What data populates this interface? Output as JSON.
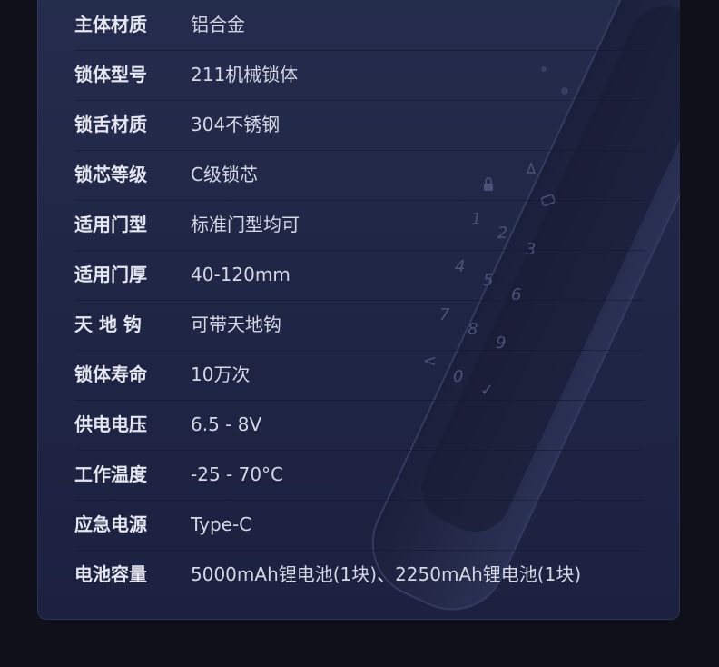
{
  "specs": [
    {
      "label": "主体材质",
      "value": "铝合金"
    },
    {
      "label": "锁体型号",
      "value": "211机械锁体"
    },
    {
      "label": "锁舌材质",
      "value": "304不锈钢"
    },
    {
      "label": "锁芯等级",
      "value": "C级锁芯"
    },
    {
      "label": "适用门型",
      "value": "标准门型均可"
    },
    {
      "label": "适用门厚",
      "value": "40-120mm"
    },
    {
      "label": "天 地 钩",
      "value": "可带天地钩"
    },
    {
      "label": "锁体寿命",
      "value": "10万次"
    },
    {
      "label": "供电电压",
      "value": "6.5 - 8V"
    },
    {
      "label": "工作温度",
      "value": "-25 - 70°C"
    },
    {
      "label": "应急电源",
      "value": "Type-C"
    },
    {
      "label": "电池容量",
      "value": "5000mAh锂电池(1块)、2250mAh锂电池(1块)"
    }
  ],
  "keypad": {
    "keys": [
      "1",
      "2",
      "3",
      "4",
      "5",
      "6",
      "7",
      "8",
      "9",
      "<",
      "0",
      "✓"
    ]
  },
  "colors": {
    "page_bg": "#0f1019",
    "panel_bg": "#232a4a",
    "label": "#e4e6f0",
    "value": "#d4d7e4"
  }
}
